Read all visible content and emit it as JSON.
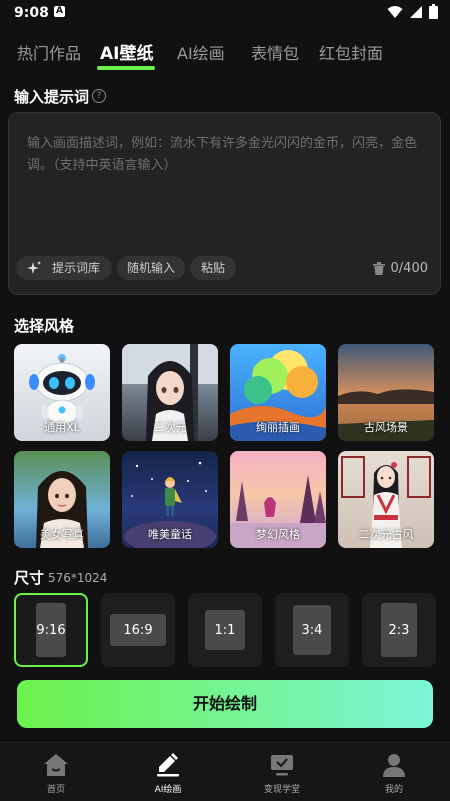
{
  "status_bar": {
    "time": "9:08",
    "notif_icon": "A"
  },
  "tabs": [
    {
      "label": "热门作品"
    },
    {
      "label": "AI壁纸"
    },
    {
      "label": "AI绘画"
    },
    {
      "label": "表情包"
    },
    {
      "label": "红包封面"
    }
  ],
  "prompt_section": {
    "title": "输入提示词",
    "placeholder": "输入画面描述词，例如：流水下有许多金光闪闪的金币，闪亮，金色调。（支持中英语言输入）",
    "value": "",
    "chips": [
      {
        "label": "提示词库"
      },
      {
        "label": "随机输入"
      },
      {
        "label": "粘贴"
      }
    ],
    "counter": "0/400"
  },
  "style_section": {
    "title": "选择风格",
    "styles": [
      {
        "label": "通用XL"
      },
      {
        "label": "二次元"
      },
      {
        "label": "绚丽插画"
      },
      {
        "label": "古风场景"
      },
      {
        "label": "美女写真"
      },
      {
        "label": "唯美童话"
      },
      {
        "label": "梦幻风格"
      },
      {
        "label": "二次元古风"
      }
    ]
  },
  "size_section": {
    "title": "尺寸",
    "current": "576*1024",
    "options": [
      {
        "label": "9:16"
      },
      {
        "label": "16:9"
      },
      {
        "label": "1:1"
      },
      {
        "label": "3:4"
      },
      {
        "label": "2:3"
      }
    ],
    "selected": "9:16"
  },
  "start_button": {
    "label": "开始绘制"
  },
  "bottom_nav": [
    {
      "label": "首页",
      "icon": "home-icon"
    },
    {
      "label": "AI绘画",
      "icon": "pen-icon"
    },
    {
      "label": "变现学堂",
      "icon": "screen-check-icon"
    },
    {
      "label": "我的",
      "icon": "user-icon"
    }
  ],
  "colors": {
    "accent": "#6cf24a",
    "accent_end": "#7cf5d8",
    "background": "#111111"
  }
}
